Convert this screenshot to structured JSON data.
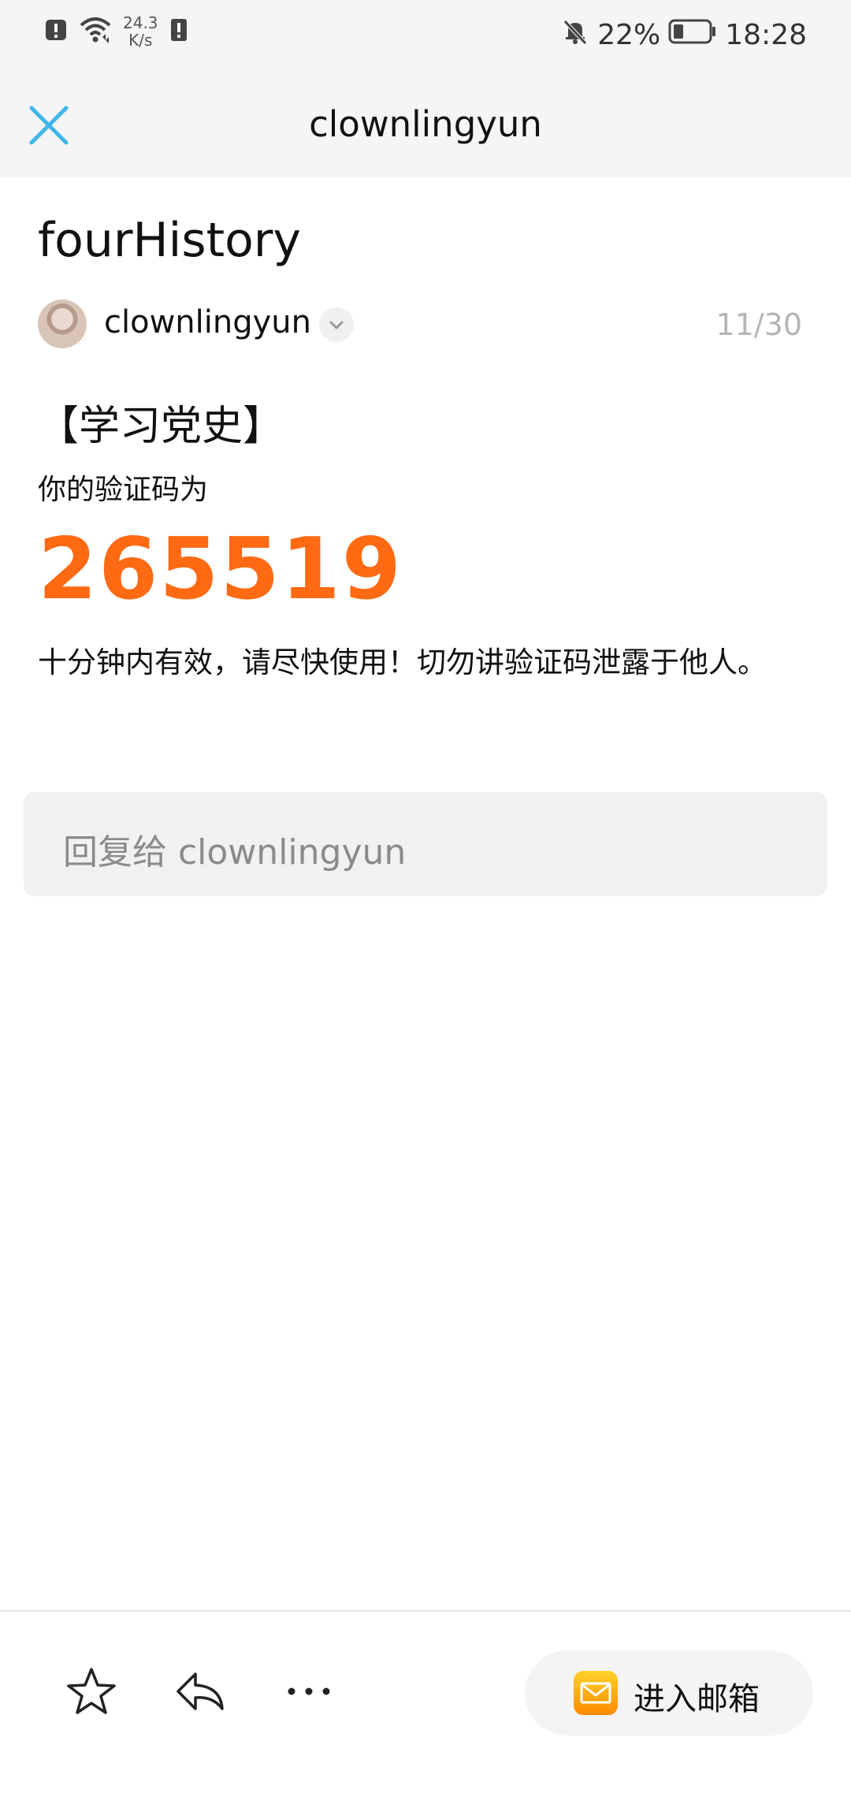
{
  "status_bar": {
    "net_speed_value": "24.3",
    "net_speed_unit": "K/s",
    "battery_percent": "22%",
    "time": "18:28",
    "icons": [
      "alert-icon",
      "wifi-icon",
      "sim-alert-icon",
      "bell-off-icon",
      "battery-icon"
    ]
  },
  "header": {
    "title": "clownlingyun",
    "close_icon": "close-icon"
  },
  "mail": {
    "subject": "fourHistory",
    "sender": "clownlingyun",
    "counter": "11/30",
    "body_heading": "【学习党史】",
    "body_line1": "你的验证码为",
    "code": "265519",
    "body_line2": "十分钟内有效，请尽快使用！切勿讲验证码泄露于他人。",
    "code_color": "#ff6a13"
  },
  "reply": {
    "placeholder": "回复给 clownlingyun"
  },
  "toolbar": {
    "star_icon": "star-icon",
    "reply_icon": "reply-icon",
    "more_icon": "more-icon",
    "enter_mailbox_label": "进入邮箱",
    "mailbox_icon": "mailbox-icon"
  },
  "colors": {
    "accent_blue": "#3fb6e8",
    "code_orange": "#ff6a13",
    "mailbox_icon_yellow": "#ffc21a"
  }
}
